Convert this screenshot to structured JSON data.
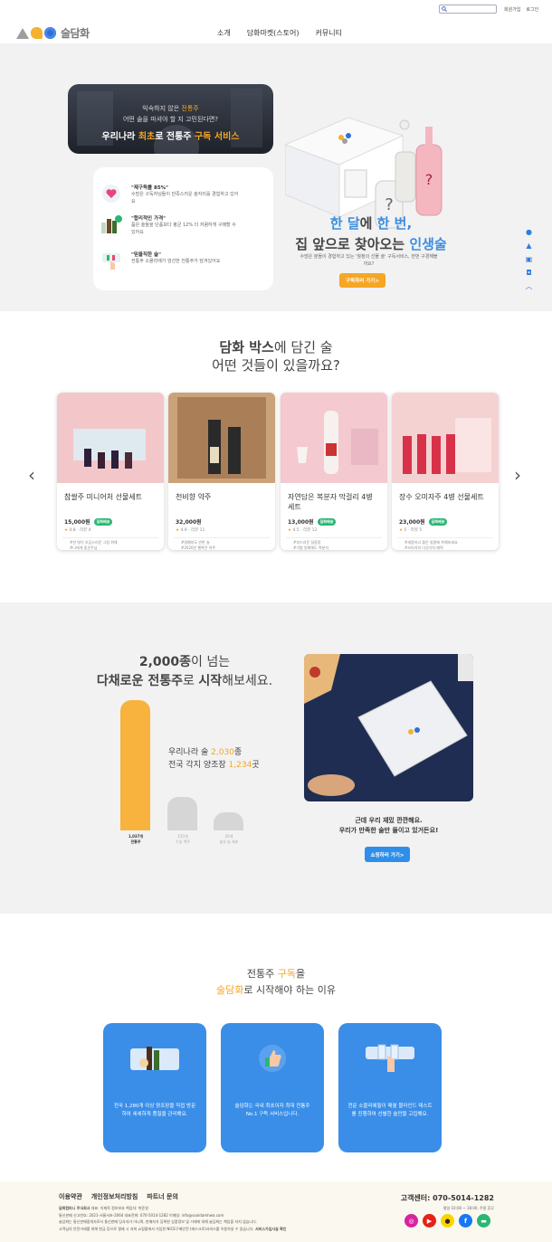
{
  "topbar": {
    "signup": "회원가입",
    "login": "로그인"
  },
  "header": {
    "logo_text": "술담화",
    "nav": [
      "소개",
      "담화마켓(스토어)",
      "커뮤니티"
    ]
  },
  "hero": {
    "banner_line1_a": "익숙하지 않은 ",
    "banner_line1_b": "전통주",
    "banner_line2": "어떤 술을 마셔야 할 지 고민된다면?",
    "banner_line3_a": "우리나라 ",
    "banner_line3_b": "최초",
    "banner_line3_c": "로 전통주 ",
    "banner_line3_d": "구독 서비스",
    "features": [
      {
        "title": "\"재구독률 85%\"",
        "desc": "수많은 구독자님들이 만족스러운 술자리를 경험하고 있어요"
      },
      {
        "title": "\"합리적인 가격\"",
        "desc": "품은 술들을 단품보다 평균 12% 더 저렴하게 구매할 수 있어요"
      },
      {
        "title": "\"믿을직한 술\"",
        "desc": "전통주 소믈리에가 엄선한 전통주가 담겨있어요"
      }
    ],
    "headline_a": "한 달",
    "headline_b": "에 ",
    "headline_c": "한 번,",
    "headline2_a": "집 앞으로 찾아오는 ",
    "headline2_b": "인생술",
    "sub": "수많은 분들이 경험하고 있는 '월정의 선물 술' 구독서비스, 한번 구경해볼까요?",
    "cta": "구독하러 가기>"
  },
  "section2": {
    "heading_a": "담화 박스",
    "heading_b": "에 담긴 술",
    "heading2": "어떤 것들이 있을까요?",
    "products": [
      {
        "name": "참쌀주 미니어처 선물세트",
        "price": "15,000원",
        "badge": "담화배송",
        "rating": "4.8",
        "reviews": "리뷰 4",
        "tags": "#한 병이 부담스러운 그럼 위해\n#나에게 좋은주님"
      },
      {
        "name": "천비향 약주",
        "price": "32,000원",
        "badge": "",
        "rating": "4.9",
        "reviews": "리뷰 11",
        "tags": "#명예미도 반한 술\n#2020년 행복큰 약주"
      },
      {
        "name": "자연담은 복분자 막걸리 4병 세트",
        "price": "13,000원",
        "badge": "담화배송",
        "rating": "4.5",
        "reviews": "리뷰 12",
        "tags": "#부드러운 달콤함\n#가볍 원해해도 복분자"
      },
      {
        "name": "장수 오미자주 4병 선물세트",
        "price": "23,000원",
        "badge": "담화배송",
        "rating": "5",
        "reviews": "리뷰 5",
        "tags": "#새콤하고 붉은 빛깔에 취해보세요\n#오미자의 다섯가지 매력"
      }
    ]
  },
  "section3": {
    "heading_a": "2,000종",
    "heading_b": "이 넘는",
    "heading2_a": "다채로운 전통주",
    "heading2_b": "로 ",
    "heading2_c": "시작",
    "heading2_d": "해보세요.",
    "stat1_a": "우리나라 술 ",
    "stat1_b": "2,030",
    "stat1_c": "종",
    "stat2_a": "전국 각지 양조장 ",
    "stat2_b": "1,234",
    "stat2_c": "곳",
    "bar_labels": [
      "1,037개\n전통주",
      "150개\n수입 맥주",
      "20개\n솔루 술 제조"
    ],
    "caption1": "근데 우리 재밌 깐깐해요.",
    "caption2": "우리가 만족한 술만 들이고 있거든요!",
    "cta": "쇼핑하러 가기>"
  },
  "section4": {
    "heading1_a": "전통주 ",
    "heading1_b": "구독",
    "heading1_c": "을",
    "heading2_a": "술담화",
    "heading2_b": "로 시작해야 하는 이유",
    "cards": [
      "전국 1,280개 이상 양조장을 직접 방문하여 세세하게 품질을 관리해요.",
      "술담화는 국내 최초이자 최대 전통주 No.1 구독 서비스입니다.",
      "전문 소믈리에들이 매월 블라인드 테스트를 진행하여 선별한 술만을 고집해요."
    ]
  },
  "footer": {
    "links": [
      "이용약관",
      "개인정보처리방침",
      "파트너 문의"
    ],
    "company": "담화컴퍼니 주식회사",
    "info1": "대표: 이재욱   정보보호 책임자: 박준영",
    "info2": "통신판매 신고번호: 2021-서울서초-2064   대표전화: 070-5014-1282   이메일: info@sooldamhwa.com",
    "info3": "술담화는 통신판매중개자로서 통신판매 당사자가 아니며, 판매자가 등록한 상품정보 및 거래에 대해 술담화는 책임을 지지 않습니다.",
    "info4": "고객님의 안전거래를 위해 현금 등으로 결제 시 저희 쇼핑몰에서 가입한 NICE구매안전 (에스크로)서비스를 이용하실 수 있습니다.",
    "escrow": "서비스가입사실 확인",
    "cs_title": "고객센터: 070-5014-1282",
    "cs_hours": "평일 10:00 ~ 18:00, 주말 휴무"
  }
}
